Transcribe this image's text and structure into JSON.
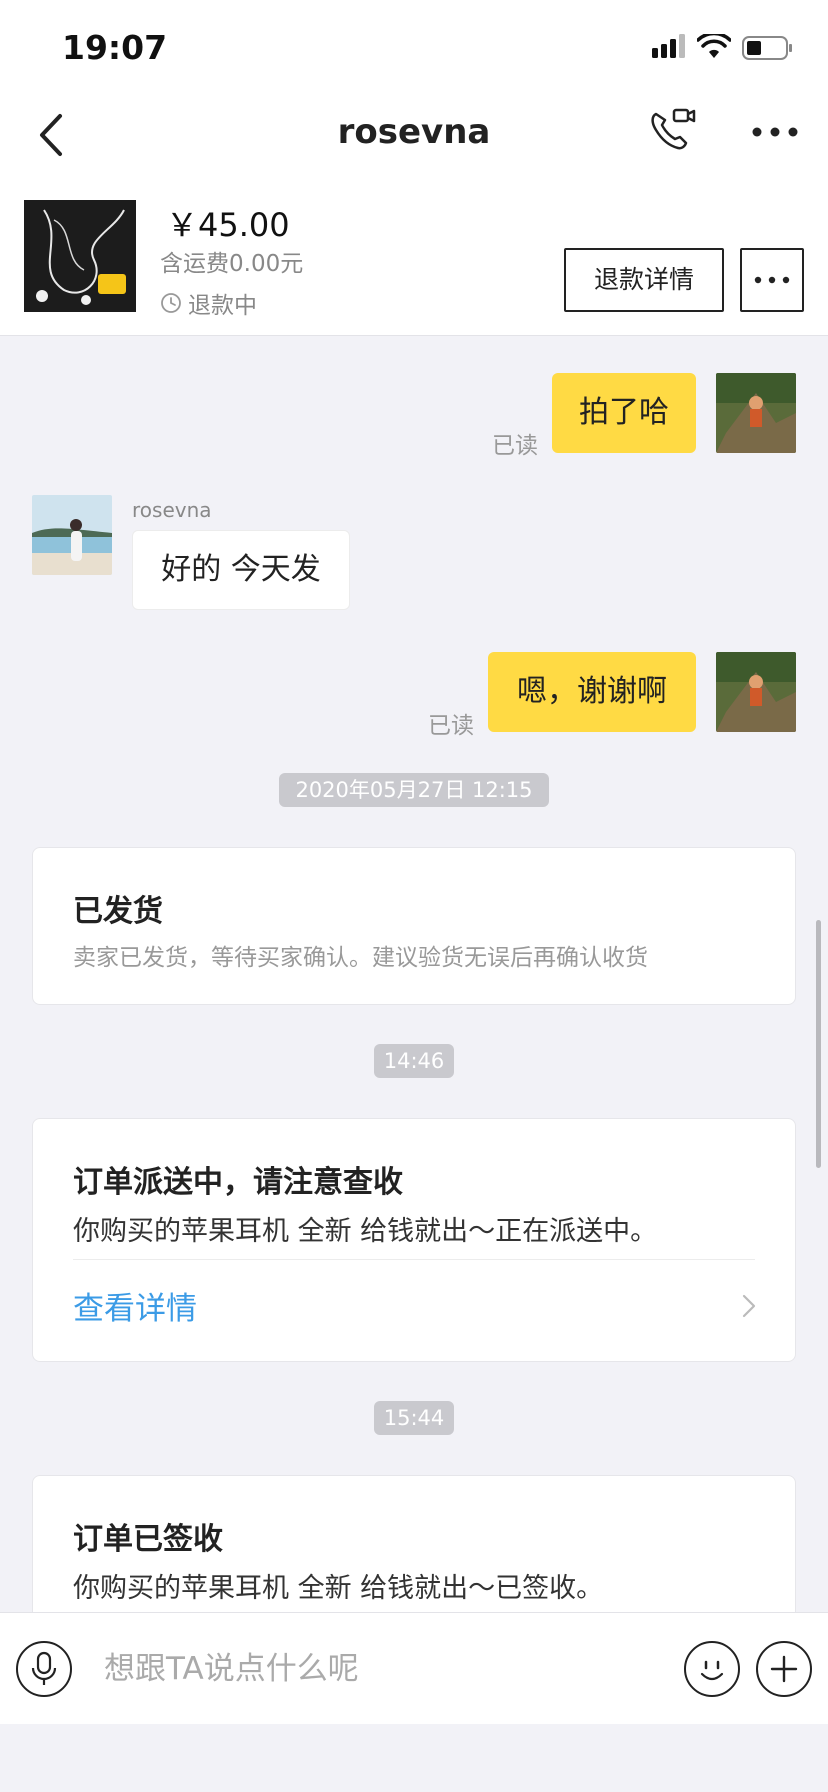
{
  "status_bar": {
    "time": "19:07"
  },
  "header": {
    "title": "rosevna"
  },
  "product": {
    "price": "￥45.00",
    "shipping": "含运费0.00元",
    "status": "退款中",
    "refund_button": "退款详情"
  },
  "messages": [
    {
      "from": "me",
      "text": "拍了哈",
      "read": "已读"
    },
    {
      "from": "other",
      "sender": "rosevna",
      "text": "好的 今天发"
    },
    {
      "from": "me",
      "text": "嗯，谢谢啊",
      "read": "已读"
    }
  ],
  "timestamps": [
    "2020年05月27日 12:15",
    "14:46",
    "15:44"
  ],
  "cards": [
    {
      "title": "已发货",
      "subtitle": "卖家已发货，等待买家确认。建议验货无误后再确认收货"
    },
    {
      "title": "订单派送中，请注意查收",
      "body": "你购买的苹果耳机 全新  给钱就出～正在派送中。",
      "link": "查看详情"
    },
    {
      "title": "订单已签收",
      "body": "你购买的苹果耳机 全新  给钱就出～已签收。"
    }
  ],
  "input": {
    "placeholder": "想跟TA说点什么呢"
  },
  "colors": {
    "my_bubble": "#ffda44",
    "link": "#3b9be6",
    "background": "#f2f2f7"
  }
}
